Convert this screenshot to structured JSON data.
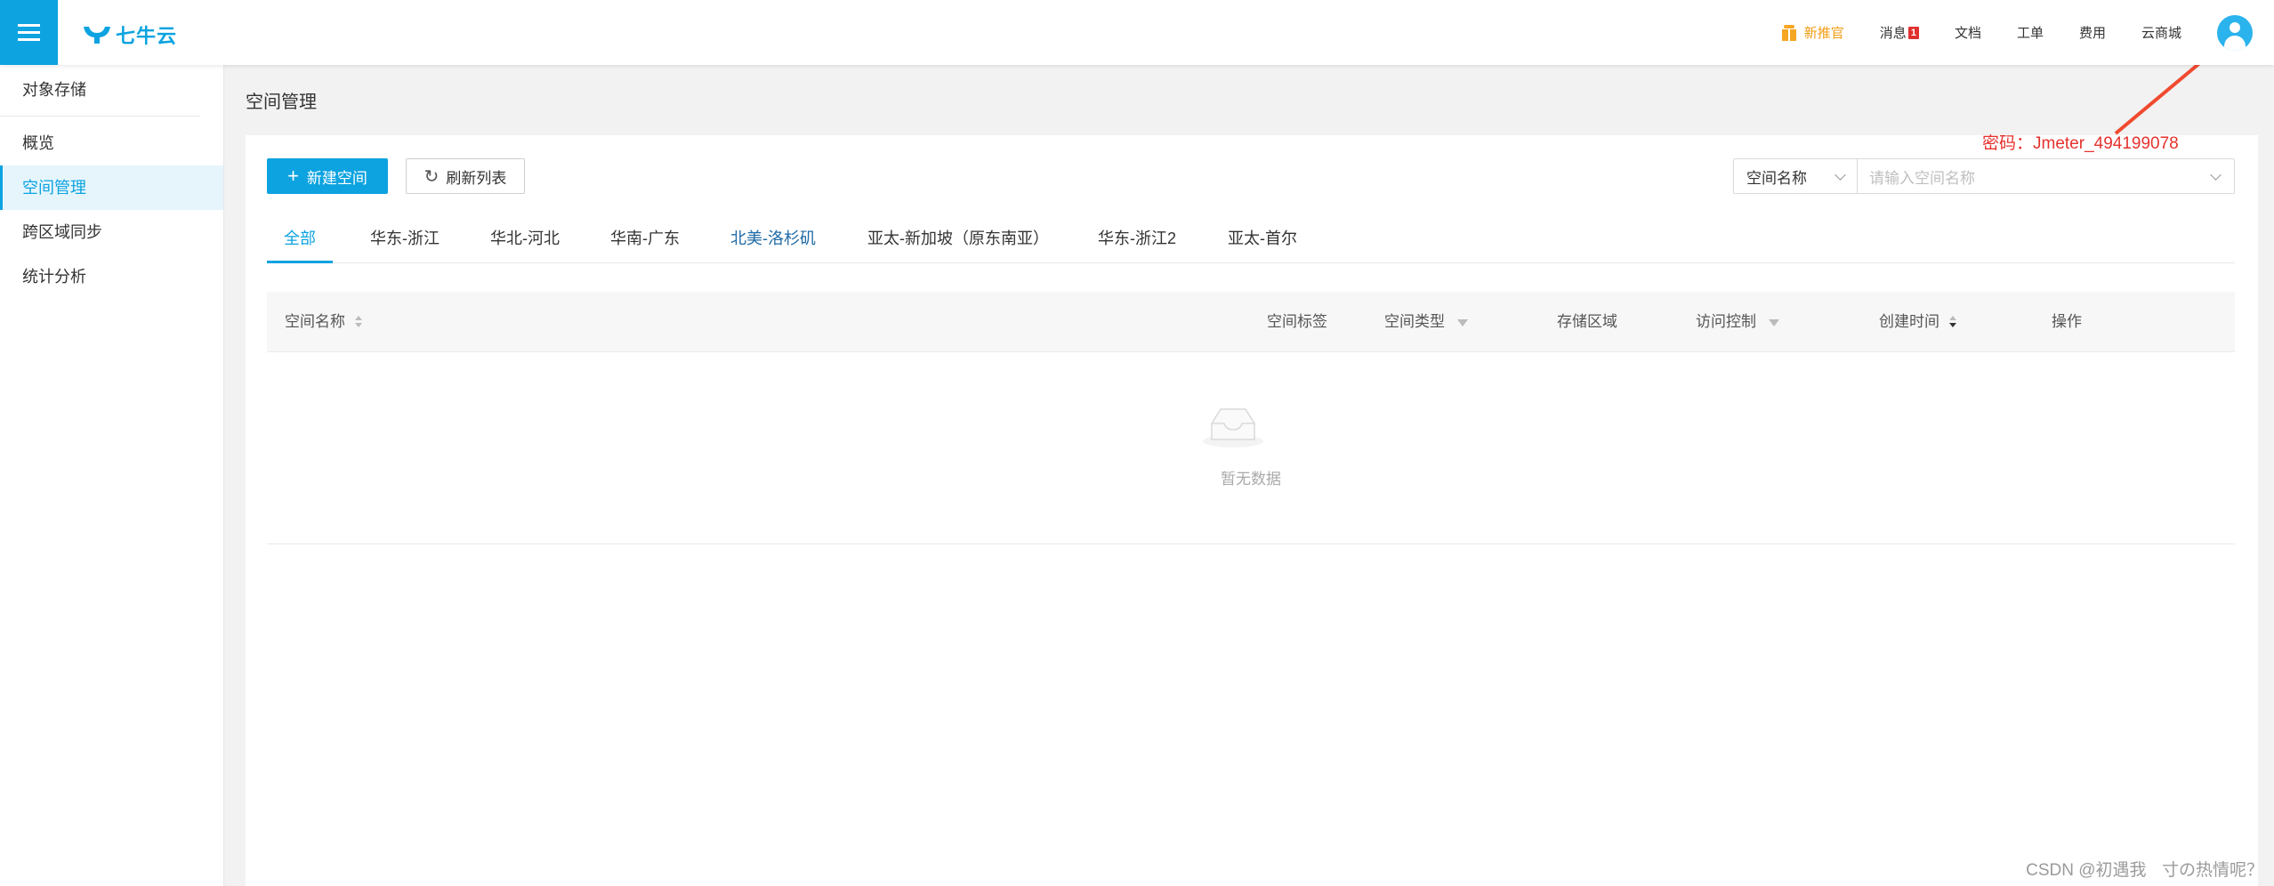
{
  "topbar": {
    "logo_text": "七牛云",
    "nav": {
      "promo": "新推官",
      "messages": "消息",
      "messages_count": "1",
      "docs": "文档",
      "tickets": "工单",
      "billing": "费用",
      "marketplace": "云商城"
    },
    "accent_color": "#0ca3e0"
  },
  "sidebar": {
    "title": "对象存储",
    "items": [
      {
        "label": "概览",
        "active": false
      },
      {
        "label": "空间管理",
        "active": true
      },
      {
        "label": "跨区域同步",
        "active": false
      },
      {
        "label": "统计分析",
        "active": false
      }
    ]
  },
  "main": {
    "page_title": "空间管理",
    "new_bucket_label": "新建空间",
    "refresh_label": "刷新列表",
    "search": {
      "field_selected": "空间名称",
      "placeholder": "请输入空间名称"
    },
    "tabs": [
      {
        "label": "全部",
        "active": true
      },
      {
        "label": "华东-浙江",
        "active": false
      },
      {
        "label": "华北-河北",
        "active": false
      },
      {
        "label": "华南-广东",
        "active": false
      },
      {
        "label": "北美-洛杉矶",
        "active": false
      },
      {
        "label": "亚太-新加坡（原东南亚）",
        "active": false
      },
      {
        "label": "华东-浙江2",
        "active": false
      },
      {
        "label": "亚太-首尔",
        "active": false
      }
    ],
    "table": {
      "columns": [
        "空间名称",
        "空间标签",
        "空间类型",
        "存储区域",
        "访问控制",
        "创建时间",
        "操作"
      ],
      "rows": [],
      "empty_text": "暂无数据"
    }
  },
  "annotation": {
    "password_text": "密码：Jmeter_494199078",
    "color": "#e5322d"
  },
  "watermark": "CSDN @初遇我ㅤ寸の热情呢？"
}
